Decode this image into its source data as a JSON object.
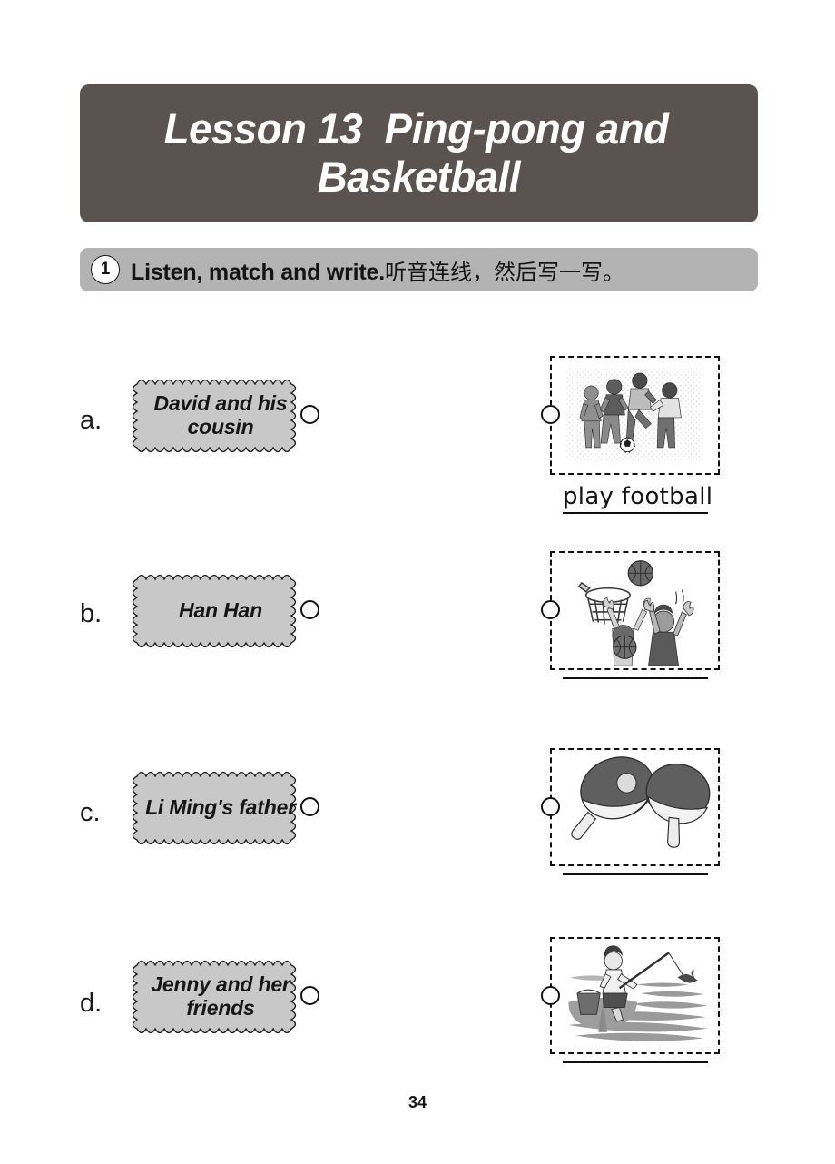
{
  "header": {
    "title_line1": "Lesson 13  Ping-pong and",
    "title_line2": "Basketball",
    "bg_color": "#5b5350",
    "text_color": "#ffffff"
  },
  "instruction": {
    "number": "1",
    "english": "Listen, match and write.",
    "chinese": "听音连线，然后写一写。",
    "bg_color": "#b3b3b3"
  },
  "exercise": {
    "rows": [
      {
        "letter": "a.",
        "bubble_label": "David and his cousin",
        "picture": "four-boys-playing-football",
        "answer": "play football"
      },
      {
        "letter": "b.",
        "bubble_label": "Han Han",
        "picture": "basketball-hoop-players",
        "answer": ""
      },
      {
        "letter": "c.",
        "bubble_label": "Li Ming's father",
        "picture": "two-ping-pong-paddles-and-ball",
        "answer": ""
      },
      {
        "letter": "d.",
        "bubble_label": "Jenny and her friends",
        "picture": "boy-fishing-at-river",
        "answer": ""
      }
    ]
  },
  "footer": {
    "page_number": "34"
  }
}
